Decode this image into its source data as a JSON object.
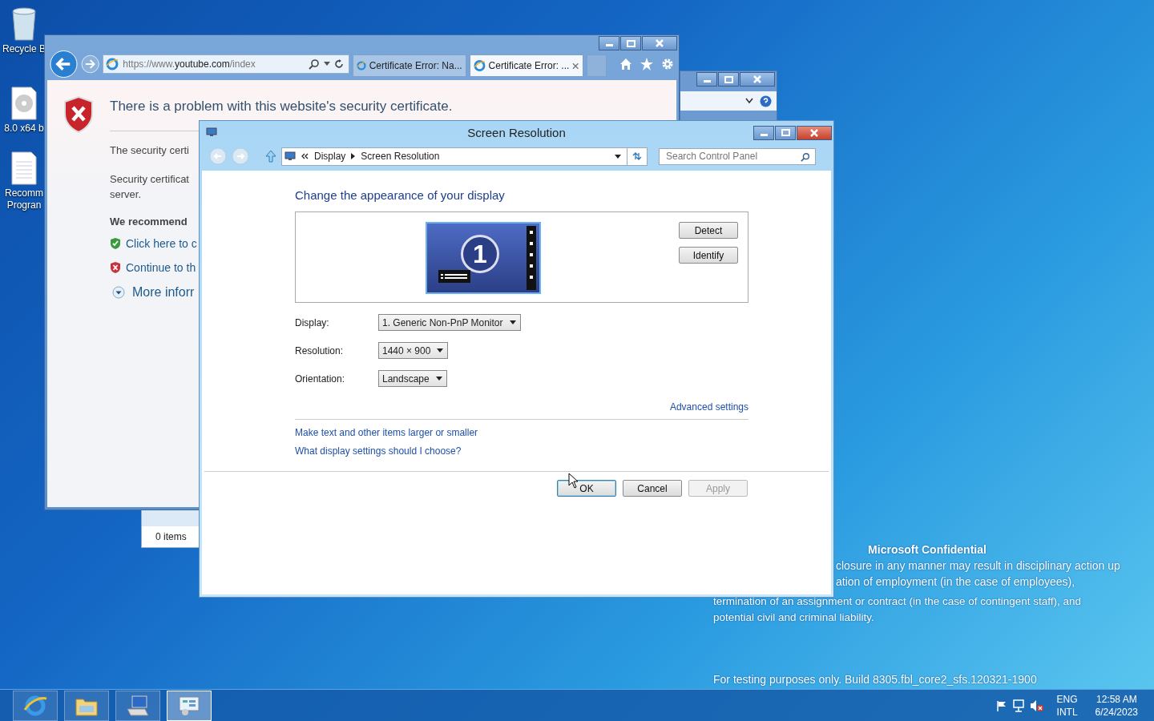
{
  "desktop": {
    "icons": [
      {
        "kind": "recycle-bin",
        "lines": [
          "Recycle B"
        ]
      },
      {
        "kind": "disc",
        "lines": [
          "8.0 x64 b"
        ]
      },
      {
        "kind": "document",
        "lines": [
          "Recomm",
          "Progran"
        ]
      }
    ],
    "notice": {
      "title": "Microsoft Confidential",
      "lines": [
        "closure in any manner may result in disciplinary action up",
        "ation of employment (in the case of employees),"
      ],
      "lines_full": [
        "termination of an assignment or contract (in the case of contingent staff), and",
        "potential civil and criminal liability."
      ],
      "build": "For testing purposes only. Build 8305.fbl_core2_sfs.120321-1900"
    }
  },
  "browser": {
    "address": {
      "prefix": "https://www.",
      "domain": "youtube.com",
      "path": "/index"
    },
    "tabs": [
      {
        "label": "Certificate Error: Na...",
        "selected": false
      },
      {
        "label": "Certificate Error: ...",
        "selected": true
      }
    ],
    "page": {
      "heading": "There is a problem with this website's security certificate.",
      "paragraphs": [
        [
          "The security certi"
        ],
        [
          "Security certificat",
          "server."
        ]
      ],
      "recommend": "We recommend",
      "options": [
        {
          "kind": "safe",
          "label": "Click here to c"
        },
        {
          "kind": "unsafe",
          "label": "Continue to th"
        }
      ],
      "more_info": "More inforr"
    }
  },
  "explorer": {
    "status": "0 items"
  },
  "dialog": {
    "title": "Screen Resolution",
    "breadcrumb": [
      "Display",
      "Screen Resolution"
    ],
    "search_placeholder": "Search Control Panel",
    "heading": "Change the appearance of your display",
    "monitor_number": "1",
    "side_buttons": [
      "Detect",
      "Identify"
    ],
    "fields": [
      {
        "label": "Display:",
        "value": "1. Generic Non-PnP Monitor"
      },
      {
        "label": "Resolution:",
        "value": "1440 × 900"
      },
      {
        "label": "Orientation:",
        "value": "Landscape"
      }
    ],
    "advanced_link": "Advanced settings",
    "links": [
      "Make text and other items larger or smaller",
      "What display settings should I choose?"
    ],
    "buttons": [
      {
        "label": "OK",
        "default": true,
        "disabled": false
      },
      {
        "label": "Cancel",
        "default": false,
        "disabled": false
      },
      {
        "label": "Apply",
        "default": false,
        "disabled": true
      }
    ]
  },
  "taskbar": {
    "apps": [
      {
        "kind": "browser",
        "active": false
      },
      {
        "kind": "folder",
        "active": false
      },
      {
        "kind": "computer",
        "active": false
      },
      {
        "kind": "control-panel",
        "active": true
      }
    ],
    "language": [
      "ENG",
      "INTL"
    ],
    "time": "12:58 AM",
    "date": "6/24/2023"
  }
}
